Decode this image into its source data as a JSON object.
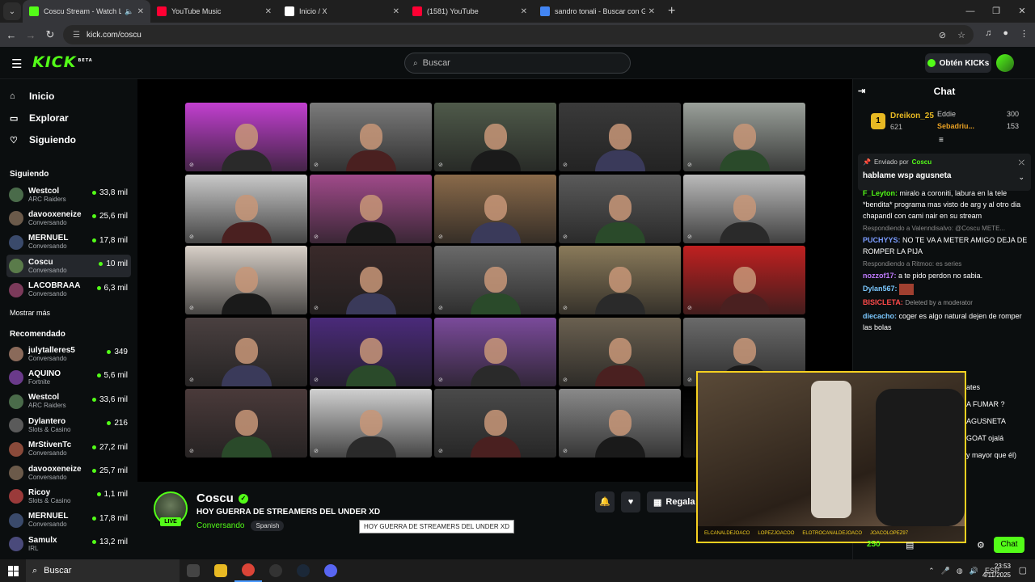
{
  "browser": {
    "tabs": [
      {
        "title": "Coscu Stream - Watch Live",
        "favicon": "kick-icon",
        "color": "#53fc18",
        "active": true
      },
      {
        "title": "YouTube Music",
        "favicon": "youtube-music-icon",
        "color": "#ff0033",
        "active": false
      },
      {
        "title": "Inicio / X",
        "favicon": "x-icon",
        "color": "#ffffff",
        "active": false
      },
      {
        "title": "(1581) YouTube",
        "favicon": "youtube-icon",
        "color": "#ff0033",
        "active": false
      },
      {
        "title": "sandro tonali - Buscar con Goo",
        "favicon": "google-icon",
        "color": "#4285f4",
        "active": false
      }
    ],
    "url": "kick.com/coscu"
  },
  "header": {
    "logo": "KICK",
    "logo_badge": "BETA",
    "search_placeholder": "Buscar",
    "kicks_button": "Obtén KICKs"
  },
  "sidebar": {
    "nav": [
      {
        "label": "Inicio",
        "icon": "home-icon"
      },
      {
        "label": "Explorar",
        "icon": "compass-icon"
      },
      {
        "label": "Siguiendo",
        "icon": "heart-icon"
      }
    ],
    "following_title": "Siguiendo",
    "following": [
      {
        "name": "Westcol",
        "category": "ARC Raiders",
        "viewers": "33,8 mil",
        "color": "#4a6b4a"
      },
      {
        "name": "davooxeneize",
        "category": "Conversando",
        "viewers": "25,6 mil",
        "color": "#6b5a4a"
      },
      {
        "name": "MERNUEL",
        "category": "Conversando",
        "viewers": "17,8 mil",
        "color": "#3a4a6b"
      },
      {
        "name": "Coscu",
        "category": "Conversando",
        "viewers": "10 mil",
        "color": "#5a7b4a"
      },
      {
        "name": "LACOBRAAA",
        "category": "Conversando",
        "viewers": "6,3 mil",
        "color": "#7b3a5a"
      }
    ],
    "show_more": "Mostrar más",
    "recommended_title": "Recomendado",
    "recommended": [
      {
        "name": "julytalleres5",
        "category": "Conversando",
        "viewers": "349",
        "color": "#8a6a5a"
      },
      {
        "name": "AQUINO",
        "category": "Fortnite",
        "viewers": "5,6 mil",
        "color": "#6a3a8a"
      },
      {
        "name": "Westcol",
        "category": "ARC Raiders",
        "viewers": "33,6 mil",
        "color": "#4a6b4a"
      },
      {
        "name": "Dylantero",
        "category": "Slots & Casino",
        "viewers": "216",
        "color": "#5a5a5a"
      },
      {
        "name": "MrStivenTc",
        "category": "Conversando",
        "viewers": "27,2 mil",
        "color": "#8a4a3a"
      },
      {
        "name": "davooxeneize",
        "category": "Conversando",
        "viewers": "25,7 mil",
        "color": "#6b5a4a"
      },
      {
        "name": "Ricoy",
        "category": "Slots & Casino",
        "viewers": "1,1 mil",
        "color": "#9a3a3a"
      },
      {
        "name": "MERNUEL",
        "category": "Conversando",
        "viewers": "17,8 mil",
        "color": "#3a4a6b"
      },
      {
        "name": "Samulx",
        "category": "IRL",
        "viewers": "13,2 mil",
        "color": "#4a4a7b"
      }
    ]
  },
  "stream": {
    "name": "Coscu",
    "title": "HOY GUERRA DE STREAMERS DEL UNDER XD",
    "category": "Conversando",
    "language": "Spanish",
    "live_badge": "LIVE",
    "gift_label": "Regala S",
    "tooltip": "HOY GUERRA DE STREAMERS DEL UNDER XD",
    "grid_colors": [
      [
        "#c23fd0",
        "#7b7b7b",
        "#4f5a4a",
        "#3a3a3a",
        "#9aa09a"
      ],
      [
        "#c9c9c9",
        "#a04a8a",
        "#8a6a4a",
        "#5a5a5a",
        "#bababa"
      ],
      [
        "#d8d0c8",
        "#3a2a2a",
        "#6a6a6a",
        "#8a7a5a",
        "#c02020"
      ],
      [
        "#4a4040",
        "#4a2a7a",
        "#7a4a9a",
        "#6a6050",
        "#6a6a6a"
      ],
      [
        "#4a3a3a",
        "#d0d0d0",
        "#4a4a4a",
        "#8a8a8a",
        "#000000"
      ]
    ]
  },
  "chat": {
    "title": "Chat",
    "leaderboard": {
      "rank": "1",
      "first_name": "Dreikon_25",
      "first_value": "621",
      "second_name": "Eddie",
      "second_value": "300",
      "third_name": "Sebadriu...",
      "third_value": "153"
    },
    "pinned_by_label": "Enviado por",
    "pinned_by": "Coscu",
    "pinned_text": "hablame wsp agusneta",
    "messages": [
      {
        "reply": "",
        "user": "F_Leyton:",
        "color": "#53fc18",
        "text": "miralo a coroniti, labura en la tele *bendita* programa mas visto de arg y al otro dia chapandl con cami nair en su stream"
      },
      {
        "reply": "Respondiendo a Valenndisalvo: @Coscu METE...",
        "user": "PUCHYYS:",
        "color": "#7b9cff",
        "text": "NO TE VA A METER AMIGO DEJA DE ROMPER LA PIJA"
      },
      {
        "reply": "Respondiendo a Ritmoo: es series",
        "user": "nozzof17:",
        "color": "#c07bff",
        "text": "a te pido perdon no sabia."
      },
      {
        "reply": "",
        "user": "Dylan567:",
        "color": "#7bc8ff",
        "text": ""
      },
      {
        "reply": "",
        "user": "BISICLETA:",
        "color": "#ff4a4a",
        "text": "Deleted by a moderator"
      },
      {
        "reply": "",
        "user": "diecacho:",
        "color": "#7bc8ff",
        "text": "coger es algo natural dejen de romper las bolas"
      }
    ],
    "fragments": [
      "ates",
      "A FUMAR ?",
      "AGUSNETA",
      "GOAT ojalá",
      "y mayor que él)"
    ],
    "points": "250",
    "chat_button": "Chat"
  },
  "pip": {
    "captions": [
      "ELCANALDEJOACO",
      "LOPEZJOACOO",
      "ELOTROCANALDEJOACO",
      "JOACOLOPEZ97"
    ]
  },
  "taskbar": {
    "search": "Buscar",
    "lang": "ESP",
    "time": "23:53",
    "date": "4/11/2025"
  }
}
